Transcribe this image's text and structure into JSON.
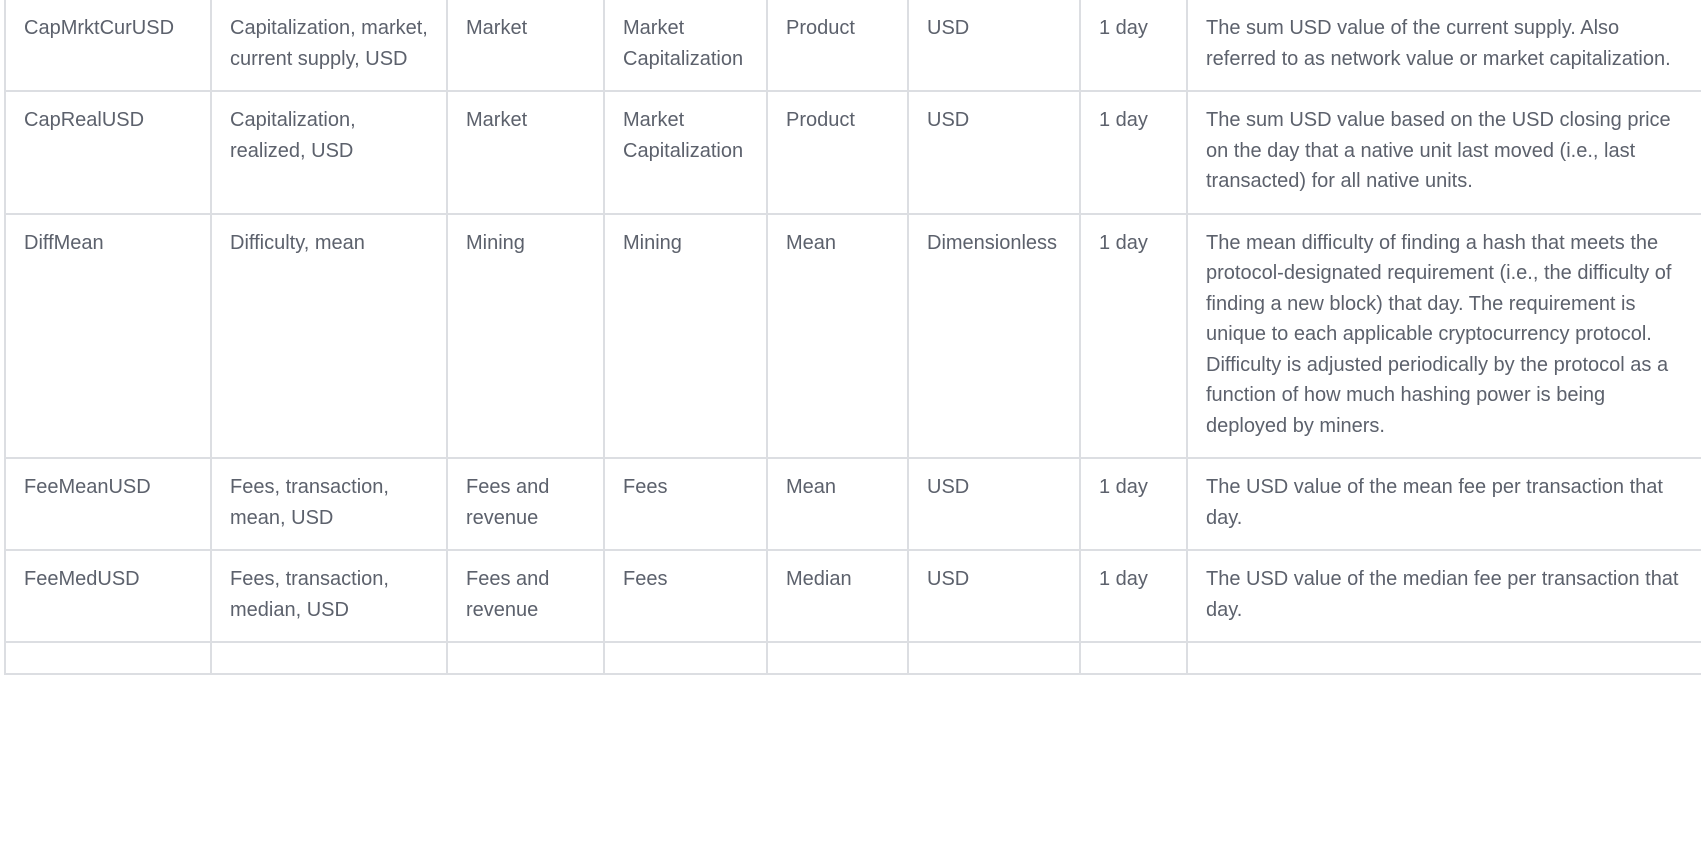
{
  "rows": [
    {
      "metric_id": "CapMrktCurUSD",
      "name": "Capitalization, market, current supply, USD",
      "category": "Market",
      "subcategory": "Market Capitalization",
      "type": "Product",
      "unit": "USD",
      "interval": "1 day",
      "description": "The sum USD value of the current supply. Also referred to as network value or market capitalization."
    },
    {
      "metric_id": "CapRealUSD",
      "name": "Capitalization, realized, USD",
      "category": "Market",
      "subcategory": "Market Capitalization",
      "type": "Product",
      "unit": "USD",
      "interval": "1 day",
      "description": "The sum USD value based on the USD closing price on the day that a native unit last moved (i.e., last transacted) for all native units."
    },
    {
      "metric_id": "DiffMean",
      "name": "Difficulty, mean",
      "category": "Mining",
      "subcategory": "Mining",
      "type": "Mean",
      "unit": "Dimensionless",
      "interval": "1 day",
      "description": "The mean difficulty of finding a hash that meets the protocol-designated requirement (i.e., the difficulty of finding a new block) that day. The requirement is unique to each applicable cryptocurrency protocol. Difficulty is adjusted periodically by the protocol as a function of how much hashing power is being deployed by miners."
    },
    {
      "metric_id": "FeeMeanUSD",
      "name": "Fees, transaction, mean, USD",
      "category": "Fees and revenue",
      "subcategory": "Fees",
      "type": "Mean",
      "unit": "USD",
      "interval": "1 day",
      "description": "The USD value of the mean fee per transaction that day."
    },
    {
      "metric_id": "FeeMedUSD",
      "name": "Fees, transaction, median, USD",
      "category": "Fees and revenue",
      "subcategory": "Fees",
      "type": "Median",
      "unit": "USD",
      "interval": "1 day",
      "description": "The USD value of the median fee per transaction that day."
    }
  ]
}
